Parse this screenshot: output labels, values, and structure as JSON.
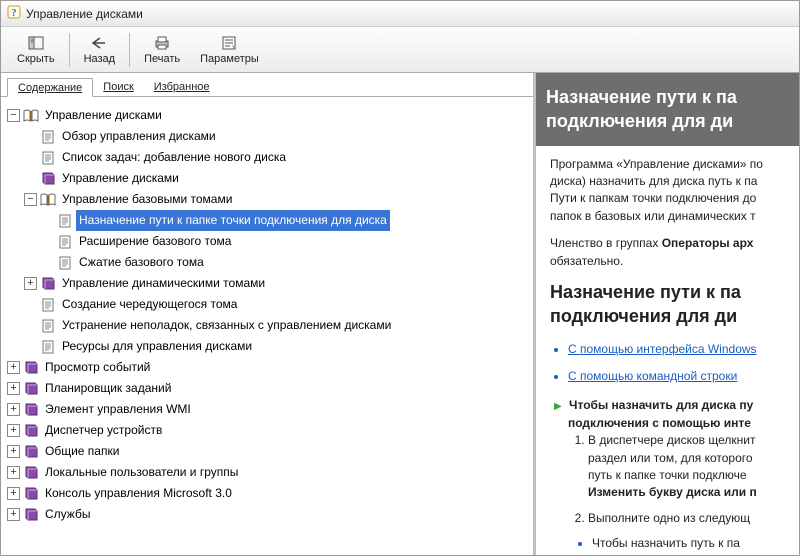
{
  "window": {
    "title": "Управление дисками"
  },
  "toolbar": {
    "hide": "Скрыть",
    "back": "Назад",
    "print": "Печать",
    "options": "Параметры"
  },
  "tabs": {
    "contents": "Содержание",
    "search": "Поиск",
    "favorites": "Избранное"
  },
  "tree": {
    "root": "Управление дисками",
    "overview": "Обзор управления дисками",
    "tasklist": "Список задач: добавление нового диска",
    "dm2": "Управление дисками",
    "basic": "Управление базовыми томами",
    "assign": "Назначение пути к папке точки подключения для диска",
    "extend": "Расширение базового тома",
    "shrink": "Сжатие базового тома",
    "dynamic": "Управление динамическими томами",
    "spanned": "Создание чередующегося тома",
    "trouble": "Устранение неполадок, связанных с управлением дисками",
    "resources": "Ресурсы для управления дисками",
    "eventv": "Просмотр событий",
    "scheduler": "Планировщик заданий",
    "wmi": "Элемент управления WMI",
    "devmgr": "Диспетчер устройств",
    "shared": "Общие папки",
    "users": "Локальные пользователи и группы",
    "mmc": "Консоль управления Microsoft 3.0",
    "services": "Службы"
  },
  "content": {
    "titleA": "Назначение пути к па",
    "titleB": "подключения для ди",
    "p1a": "Программа «Управление дисками» по",
    "p1b": "диска) назначить для диска путь к па",
    "p1c": "Пути к папкам точки подключения до",
    "p1d": "папок в базовых или динамических т",
    "p2a": "Членство в группах ",
    "p2b": "Операторы арх",
    "p2c": "обязательно.",
    "h2a": "Назначение пути к па",
    "h2b": "подключения для ди",
    "link1": "С помощью интерфейса Windows",
    "link2": "С помощью командной строки",
    "arrA": "Чтобы назначить для диска пу",
    "arrB": "подключения с помощью инте",
    "ol1a": "В диспетчере дисков щелкнит",
    "ol1b": "раздел или том, для которого",
    "ol1c": "путь к папке точки подключе",
    "ol1d": "Изменить букву диска или п",
    "ol2": "Выполните одно из следующ",
    "ol3": "Чтобы назначить путь к па"
  }
}
